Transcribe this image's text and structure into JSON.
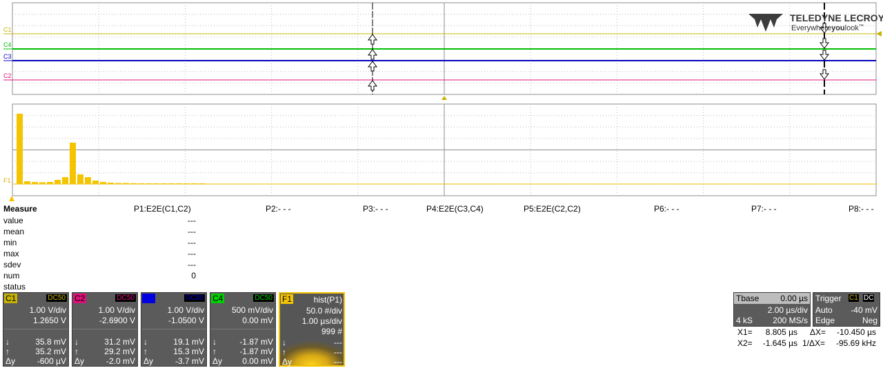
{
  "logo": {
    "brand": "TELEDYNE LECROY",
    "tagline_pre": "Everywhere",
    "tagline_mid": "you",
    "tagline_post": "look",
    "tm": "™"
  },
  "colors": {
    "c1": "#c8b400",
    "c2": "#e0107a",
    "c3": "#0000c0",
    "c4": "#00c000",
    "f1": "#f5c400",
    "grid": "#8c8c8c"
  },
  "traces": {
    "c1_label": "C1",
    "c2_label": "C2",
    "c3_label": "C3",
    "c4_label": "C4",
    "f1_label": "F1"
  },
  "histogram": {
    "type": "bar",
    "bins": [
      10.2,
      0.4,
      0.3,
      0.25,
      0.3,
      0.6,
      1.0,
      6.0,
      1.4,
      1.0,
      0.5,
      0.3,
      0.2,
      0.15,
      0.15,
      0.12,
      0.1,
      0.1,
      0.08,
      0.05,
      0.05,
      0.04,
      0.03,
      0.03,
      0.03
    ]
  },
  "measure": {
    "title": "Measure",
    "params": [
      "P1:E2E(C1,C2)",
      "P2:- - -",
      "P3:- - -",
      "P4:E2E(C3,C4)",
      "P5:E2E(C2,C2)",
      "P6:- - -",
      "P7:- - -",
      "P8:- - -"
    ],
    "rows": [
      {
        "label": "value",
        "p1": "---"
      },
      {
        "label": "mean",
        "p1": "---"
      },
      {
        "label": "min",
        "p1": "---"
      },
      {
        "label": "max",
        "p1": "---"
      },
      {
        "label": "sdev",
        "p1": "---"
      },
      {
        "label": "num",
        "p1": "0"
      },
      {
        "label": "status",
        "p1": ""
      }
    ]
  },
  "channels": [
    {
      "tag": "C1",
      "coupling": "DC50",
      "vdiv": "1.00 V/div",
      "offset": "1.2650 V",
      "down": "35.8 mV",
      "up": "35.2 mV",
      "dy": "-600 µV"
    },
    {
      "tag": "C2",
      "coupling": "DC50",
      "vdiv": "1.00 V/div",
      "offset": "-2.6900 V",
      "down": "31.2 mV",
      "up": "29.2 mV",
      "dy": "-2.0 mV"
    },
    {
      "tag": "C3",
      "coupling": "DC50",
      "vdiv": "1.00 V/div",
      "offset": "-1.0500 V",
      "down": "19.1 mV",
      "up": "15.3 mV",
      "dy": "-3.7 mV"
    },
    {
      "tag": "C4",
      "coupling": "DC50",
      "vdiv": "500 mV/div",
      "offset": "0.00 mV",
      "down": "-1.87 mV",
      "up": "-1.87 mV",
      "dy": "0.00 mV"
    }
  ],
  "arrows": {
    "down": "↓",
    "up": "↑",
    "dy": "Δy"
  },
  "f1": {
    "tag": "F1",
    "func": "hist(P1)",
    "l1": "50.0 #/div",
    "l2": "1.00 µs/div",
    "l3": "999 #",
    "d1": "---",
    "d2": "---",
    "d3": "---"
  },
  "tbase": {
    "label": "Tbase",
    "delay": "0.00 µs",
    "tdiv": "2.00 µs/div",
    "samples": "4 kS",
    "rate": "200 MS/s"
  },
  "trigger": {
    "label": "Trigger",
    "src": "C1",
    "coup": "DC",
    "mode": "Auto",
    "level": "-40 mV",
    "type": "Edge",
    "slope": "Neg"
  },
  "cursors": {
    "x1_lbl": "X1=",
    "x1": "8.805 µs",
    "dx_lbl": "ΔX=",
    "dx": "-10.450 µs",
    "x2_lbl": "X2=",
    "x2": "-1.645 µs",
    "inv_lbl": "1/ΔX=",
    "inv": "-95.69 kHz"
  }
}
